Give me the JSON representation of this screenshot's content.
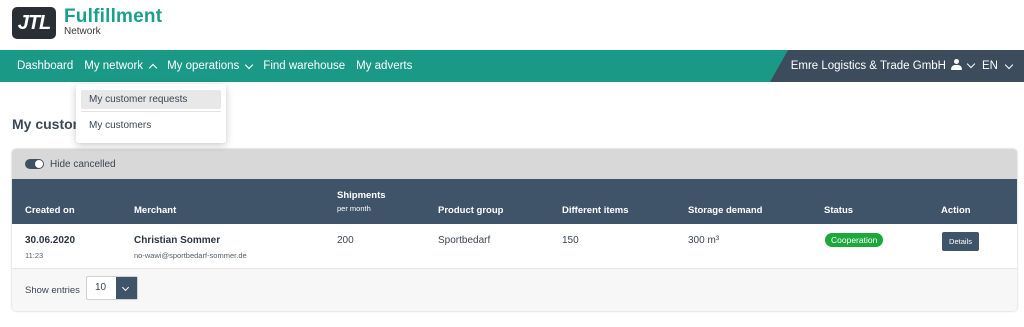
{
  "brand": {
    "logo": "JTL",
    "name": "Fulfillment",
    "sub": "Network"
  },
  "nav": {
    "items": [
      {
        "label": "Dashboard"
      },
      {
        "label": "My network"
      },
      {
        "label": "My operations"
      },
      {
        "label": "Find warehouse"
      },
      {
        "label": "My adverts"
      }
    ],
    "company": "Emre Logistics & Trade GmbH",
    "language": "EN"
  },
  "dropdown": {
    "items": [
      "My customer requests",
      "My customers"
    ]
  },
  "page": {
    "title": "My custom"
  },
  "filter": {
    "toggle_label": "Hide cancelled"
  },
  "table": {
    "headers": {
      "created_on": "Created on",
      "merchant": "Merchant",
      "shipments": "Shipments",
      "shipments_sub": "per month",
      "product_group": "Product group",
      "different_items": "Different items",
      "storage_demand": "Storage demand",
      "status": "Status",
      "action": "Action"
    },
    "rows": [
      {
        "date": "30.06.2020",
        "time": "11:23",
        "merchant_name": "Christian Sommer",
        "merchant_email": "no-wawi@sportbedarf-sommer.de",
        "shipments": "200",
        "product_group": "Sportbedarf",
        "different_items": "150",
        "storage_demand": "300 m³",
        "status": "Cooperation",
        "action": "Details"
      }
    ]
  },
  "footer": {
    "show_entries_label": "Show entries",
    "entries_value": "10"
  },
  "colors": {
    "teal": "#1a9a86",
    "navy": "#3f5468",
    "status_green": "#1ca83a"
  }
}
